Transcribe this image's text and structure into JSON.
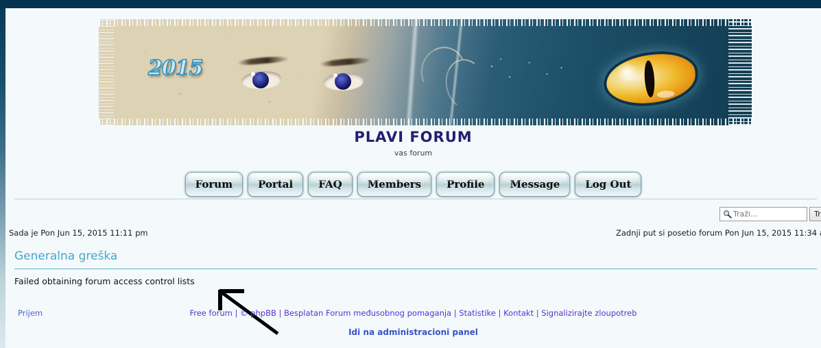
{
  "banner": {
    "year_text": "2015",
    "alt": "forum banner with human eyes and cat eye"
  },
  "header": {
    "title": "PLAVI FORUM",
    "subtitle": "vas forum"
  },
  "nav": {
    "items": [
      {
        "label": "Forum",
        "name": "nav-forum"
      },
      {
        "label": "Portal",
        "name": "nav-portal"
      },
      {
        "label": "FAQ",
        "name": "nav-faq"
      },
      {
        "label": "Members",
        "name": "nav-members"
      },
      {
        "label": "Profile",
        "name": "nav-profile"
      },
      {
        "label": "Message",
        "name": "nav-message"
      },
      {
        "label": "Log Out",
        "name": "nav-logout"
      }
    ]
  },
  "search": {
    "placeholder": "Traži...",
    "value": "",
    "button_label": "Traži",
    "icon": "search-icon"
  },
  "info": {
    "current_time": "Sada je Pon Jun 15, 2015 11:11 pm",
    "last_visit": "Zadnji put si posetio forum Pon Jun 15, 2015 11:34 a"
  },
  "error": {
    "title": "Generalna greška",
    "message": "Failed obtaining forum access control lists"
  },
  "footer": {
    "home_link": "Prijem",
    "links": [
      "Free forum",
      "© phpBB",
      "Besplatan Forum međusobnog pomaganja",
      "Statistike",
      "Kontakt",
      "Signalizirajte zloupotreb"
    ],
    "separator": "|",
    "admin_link": "Idi na administracioni panel"
  },
  "colors": {
    "topbar": "#063350",
    "page_bg": "#f4fafb",
    "title": "#241d72",
    "error_title": "#4aa3cc",
    "link_blue": "#4b5fe0",
    "link_purple": "#5b2fd4",
    "admin_link": "#3a52c8"
  }
}
